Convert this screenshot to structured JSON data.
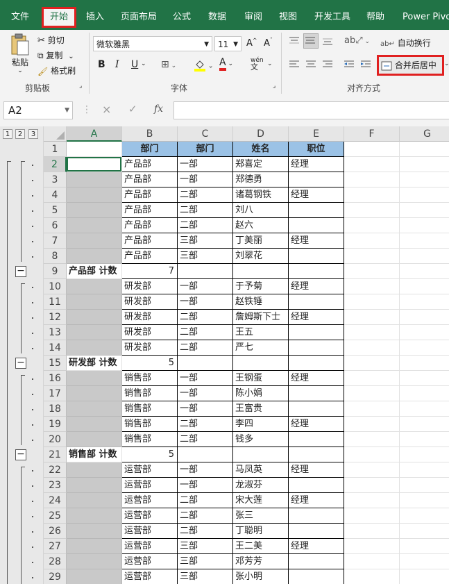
{
  "ribbon_tabs": [
    "文件",
    "开始",
    "插入",
    "页面布局",
    "公式",
    "数据",
    "审阅",
    "视图",
    "开发工具",
    "帮助",
    "Power Pivot"
  ],
  "active_tab": "开始",
  "clipboard": {
    "paste": "粘贴",
    "cut": "剪切",
    "copy": "复制",
    "format_painter": "格式刷",
    "group_label": "剪贴板"
  },
  "font": {
    "name": "微软雅黑",
    "size": "11",
    "bold": "B",
    "italic": "I",
    "underline": "U",
    "group_label": "字体",
    "grow_icon": "A^",
    "shrink_icon": "Aˇ",
    "pinyin": "wén",
    "font_color": "#e02020",
    "fill_color": "#ffff00"
  },
  "alignment": {
    "wrap_text": "自动换行",
    "merge_center": "合并后居中",
    "group_label": "对齐方式"
  },
  "formula_bar": {
    "name_box": "A2",
    "cancel_icon": "×",
    "enter_icon": "✓",
    "fx_icon": "fx",
    "value": ""
  },
  "outline_levels": [
    "1",
    "2",
    "3"
  ],
  "column_headers": [
    "A",
    "B",
    "C",
    "D",
    "E",
    "F",
    "G"
  ],
  "row_numbers": [
    "1",
    "2",
    "3",
    "4",
    "5",
    "6",
    "7",
    "8",
    "9",
    "10",
    "11",
    "12",
    "13",
    "14",
    "15",
    "16",
    "17",
    "18",
    "19",
    "20",
    "21",
    "22",
    "23",
    "24",
    "25",
    "26",
    "27",
    "28",
    "29"
  ],
  "header_row": [
    "",
    "部门",
    "部门",
    "姓名",
    "职位"
  ],
  "rows": [
    {
      "a": "",
      "b": "产品部",
      "c": "一部",
      "d": "郑喜定",
      "e": "经理"
    },
    {
      "a": "",
      "b": "产品部",
      "c": "一部",
      "d": "郑德勇",
      "e": ""
    },
    {
      "a": "",
      "b": "产品部",
      "c": "二部",
      "d": "诸葛钢铁",
      "e": "经理"
    },
    {
      "a": "",
      "b": "产品部",
      "c": "二部",
      "d": "刘八",
      "e": ""
    },
    {
      "a": "",
      "b": "产品部",
      "c": "二部",
      "d": "赵六",
      "e": ""
    },
    {
      "a": "",
      "b": "产品部",
      "c": "三部",
      "d": "丁美丽",
      "e": "经理"
    },
    {
      "a": "",
      "b": "产品部",
      "c": "三部",
      "d": "刘翠花",
      "e": ""
    },
    {
      "subtotal": true,
      "a": "产品部 计数",
      "b": "7"
    },
    {
      "a": "",
      "b": "研发部",
      "c": "一部",
      "d": "于予菊",
      "e": "经理"
    },
    {
      "a": "",
      "b": "研发部",
      "c": "一部",
      "d": "赵铁锤",
      "e": ""
    },
    {
      "a": "",
      "b": "研发部",
      "c": "二部",
      "d": "詹姆斯下士",
      "e": "经理"
    },
    {
      "a": "",
      "b": "研发部",
      "c": "二部",
      "d": "王五",
      "e": ""
    },
    {
      "a": "",
      "b": "研发部",
      "c": "二部",
      "d": "严七",
      "e": ""
    },
    {
      "subtotal": true,
      "a": "研发部 计数",
      "b": "5"
    },
    {
      "a": "",
      "b": "销售部",
      "c": "一部",
      "d": "王钢蛋",
      "e": "经理"
    },
    {
      "a": "",
      "b": "销售部",
      "c": "一部",
      "d": "陈小娟",
      "e": ""
    },
    {
      "a": "",
      "b": "销售部",
      "c": "一部",
      "d": "王富贵",
      "e": ""
    },
    {
      "a": "",
      "b": "销售部",
      "c": "二部",
      "d": "李四",
      "e": "经理"
    },
    {
      "a": "",
      "b": "销售部",
      "c": "二部",
      "d": "钱多",
      "e": ""
    },
    {
      "subtotal": true,
      "a": "销售部 计数",
      "b": "5"
    },
    {
      "a": "",
      "b": "运营部",
      "c": "一部",
      "d": "马凤英",
      "e": "经理"
    },
    {
      "a": "",
      "b": "运营部",
      "c": "一部",
      "d": "龙淑芬",
      "e": ""
    },
    {
      "a": "",
      "b": "运营部",
      "c": "二部",
      "d": "宋大莲",
      "e": "经理"
    },
    {
      "a": "",
      "b": "运营部",
      "c": "二部",
      "d": "张三",
      "e": ""
    },
    {
      "a": "",
      "b": "运营部",
      "c": "二部",
      "d": "丁聪明",
      "e": ""
    },
    {
      "a": "",
      "b": "运营部",
      "c": "三部",
      "d": "王二美",
      "e": "经理"
    },
    {
      "a": "",
      "b": "运营部",
      "c": "三部",
      "d": "邓芳芳",
      "e": ""
    },
    {
      "a": "",
      "b": "运营部",
      "c": "三部",
      "d": "张小明",
      "e": ""
    }
  ],
  "colors": {
    "excel_green": "#217346",
    "highlight_red": "#e02020",
    "header_fill": "#9bc2e6",
    "gray_fill": "#c9c9c9"
  }
}
